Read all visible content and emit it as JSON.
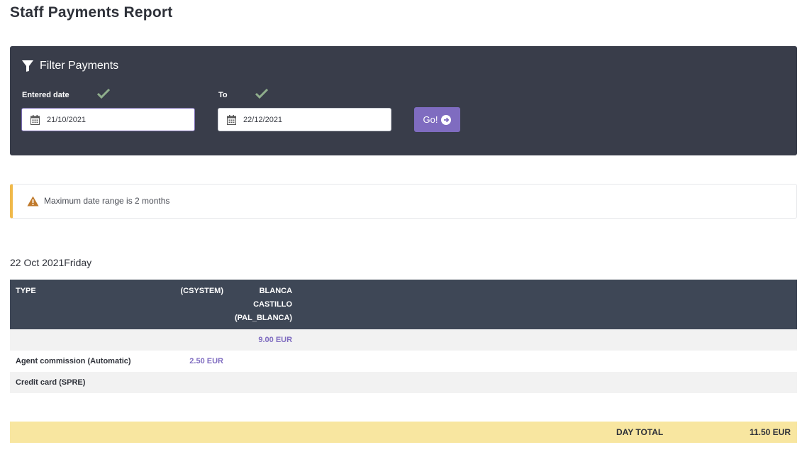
{
  "page": {
    "title": "Staff Payments Report"
  },
  "filter": {
    "heading": "Filter Payments",
    "from_label": "Entered date",
    "from_value": "21/10/2021",
    "to_label": "To",
    "to_value": "22/12/2021",
    "go_label": "Go!",
    "icons": {
      "heading": "filter-icon",
      "valid": "check-icon",
      "date": "calendar-icon",
      "go": "arrow-circle-right-icon"
    }
  },
  "alert": {
    "text": "Maximum date range is 2 months",
    "icon": "warning-icon",
    "accent": "#f0b94a"
  },
  "day": {
    "heading": "22 Oct 2021Friday",
    "columns": [
      "TYPE",
      "(CSYSTEM)",
      "BLANCA CASTILLO (PAL_BLANCA)"
    ],
    "rows": [
      {
        "type": "",
        "csystem": "",
        "blanca": "9.00 EUR"
      },
      {
        "type": "Agent commission (Automatic)",
        "csystem": "2.50 EUR",
        "blanca": ""
      },
      {
        "type": "Credit card (SPRE)",
        "csystem": "",
        "blanca": ""
      }
    ],
    "total_label": "DAY TOTAL",
    "total_value": "11.50 EUR"
  },
  "colors": {
    "panel": "#393d4a",
    "button": "#7f6cc0",
    "table_header": "#3e4756",
    "total_band": "#f8e6a0",
    "check": "#8fae8c"
  }
}
